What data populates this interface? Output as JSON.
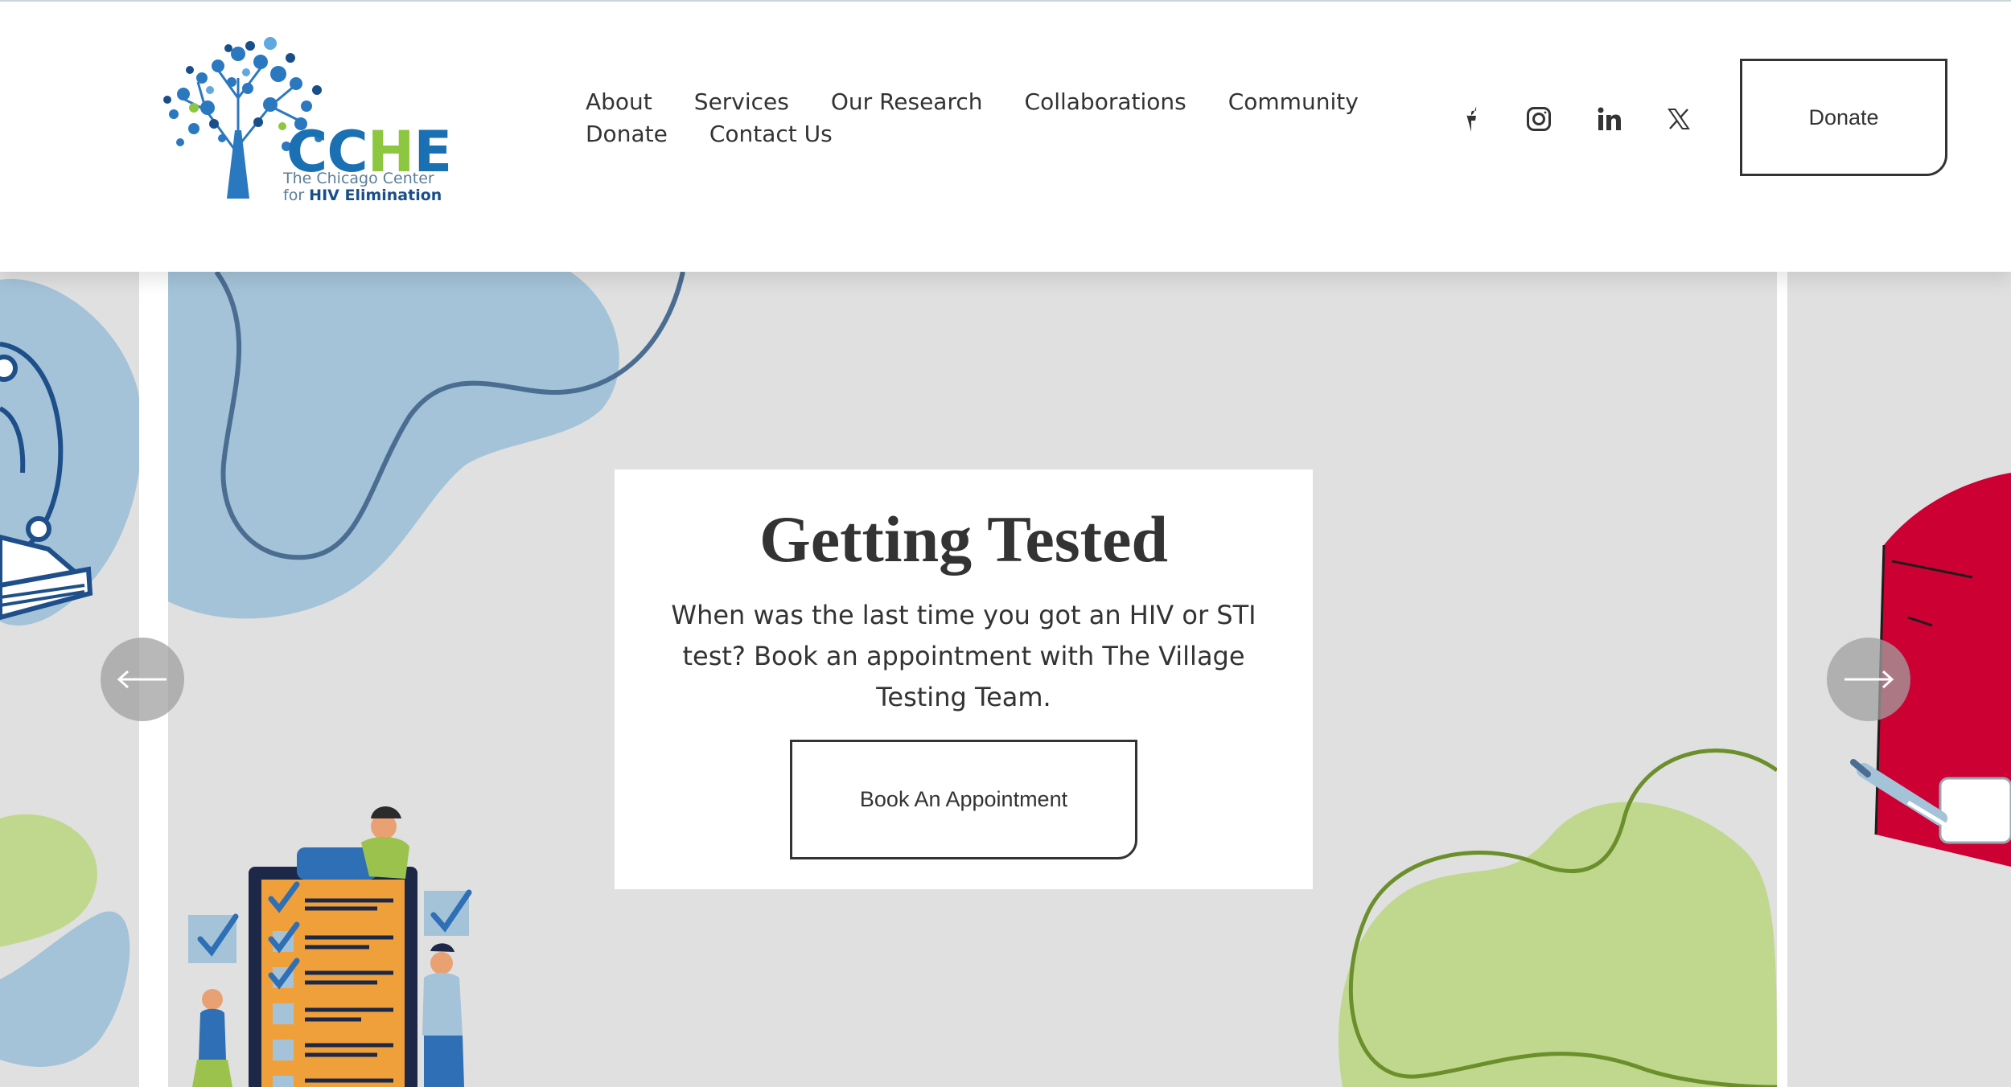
{
  "header": {
    "logo": {
      "word_part1": "CC",
      "word_part2": "H",
      "word_part3": "E",
      "sub_line1": "The Chicago Center",
      "sub_line2_prefix": "for ",
      "sub_line2_strong": "HIV Elimination"
    },
    "nav": {
      "row1": [
        "About",
        "Services",
        "Our Research",
        "Collaborations",
        "Community"
      ],
      "row2": [
        "Donate",
        "Contact Us"
      ]
    },
    "social": [
      "facebook-icon",
      "instagram-icon",
      "linkedin-icon",
      "x-twitter-icon"
    ],
    "donate_label": "Donate"
  },
  "hero": {
    "title": "Getting Tested",
    "body": "When was the last time you got an HIV or STI test? Book an appointment with The Village Testing Team.",
    "cta_label": "Book An Appointment",
    "prev_icon": "arrow-left-icon",
    "next_icon": "arrow-right-icon"
  },
  "colors": {
    "brand_blue": "#1b6fb3",
    "brand_green": "#8dc63f",
    "slide_bg": "#e0e0e0",
    "blob_blue": "#a4c3d9",
    "blob_green": "#c0d88e",
    "text": "#333333"
  }
}
